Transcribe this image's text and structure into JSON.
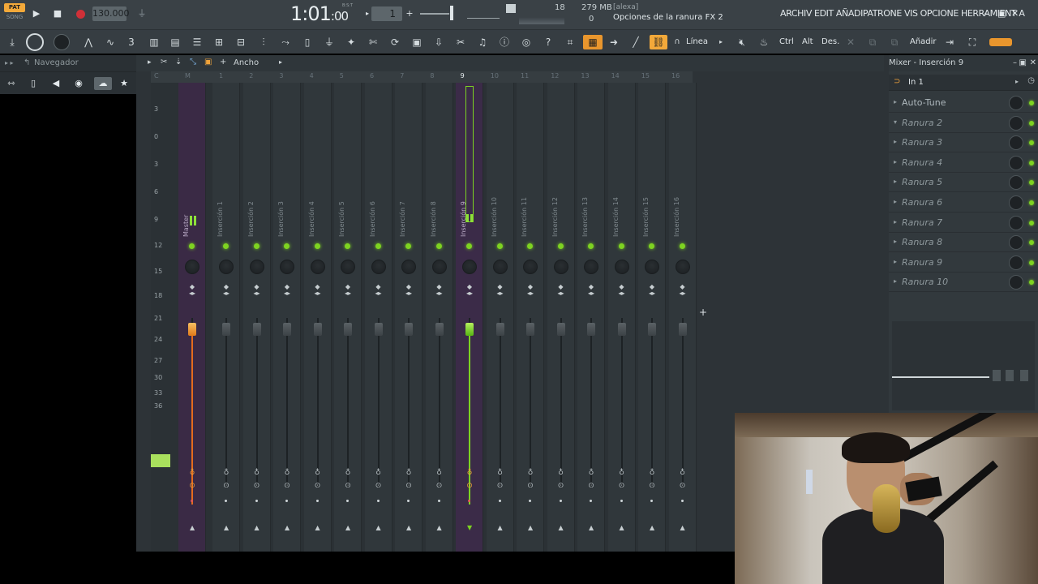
{
  "transport": {
    "pat_label": "PAT",
    "song_label": "SONG",
    "tempo": "130.000",
    "time_main": "1:01",
    "time_sub": ":00",
    "time_unit": "B:S:T",
    "pattern": "1",
    "cpu": "18",
    "mem": "279 MB",
    "voices": "0",
    "hint_title": "[alexa]",
    "hint_text": "Opciones de la ranura FX 2",
    "menu": "ARCHIV EDIT AÑADIPATRONE VIS OPCIONE HERRAMIENT A"
  },
  "toolbar": {
    "line_label": "Línea",
    "ctrl_label": "Ctrl",
    "alt_label": "Alt",
    "des_label": "Des.",
    "add_label": "Añadir"
  },
  "navigator": {
    "title": "Navegador"
  },
  "mixer": {
    "title": "Mixer - Inserción 9",
    "view_label": "Ancho",
    "input": "In 1",
    "db_scale": [
      "3",
      "0",
      "3",
      "6",
      "9",
      "12",
      "15",
      "18",
      "21",
      "24",
      "27",
      "30",
      "33",
      "36"
    ],
    "ruler": [
      "C",
      "M",
      "1",
      "2",
      "3",
      "4",
      "5",
      "6",
      "7",
      "8",
      "9",
      "10",
      "11",
      "12",
      "13",
      "14",
      "15",
      "16"
    ],
    "strips": [
      {
        "label": "Master",
        "type": "master"
      },
      {
        "label": "Inserción 1",
        "type": "normal"
      },
      {
        "label": "Inserción 2",
        "type": "normal"
      },
      {
        "label": "Inserción 3",
        "type": "normal"
      },
      {
        "label": "Inserción 4",
        "type": "normal"
      },
      {
        "label": "Inserción 5",
        "type": "normal"
      },
      {
        "label": "Inserción 6",
        "type": "normal"
      },
      {
        "label": "Inserción 7",
        "type": "normal"
      },
      {
        "label": "Inserción 8",
        "type": "normal"
      },
      {
        "label": "Inserción 9",
        "type": "selected"
      },
      {
        "label": "Inserción 10",
        "type": "normal"
      },
      {
        "label": "Inserción 11",
        "type": "normal"
      },
      {
        "label": "Inserción 12",
        "type": "normal"
      },
      {
        "label": "Inserción 13",
        "type": "normal"
      },
      {
        "label": "Inserción 14",
        "type": "normal"
      },
      {
        "label": "Inserción 15",
        "type": "normal"
      },
      {
        "label": "Inserción 16",
        "type": "normal"
      }
    ],
    "slots": [
      {
        "name": "Auto-Tune",
        "filled": true
      },
      {
        "name": "Ranura 2",
        "filled": false
      },
      {
        "name": "Ranura 3",
        "filled": false
      },
      {
        "name": "Ranura 4",
        "filled": false
      },
      {
        "name": "Ranura 5",
        "filled": false
      },
      {
        "name": "Ranura 6",
        "filled": false
      },
      {
        "name": "Ranura 7",
        "filled": false
      },
      {
        "name": "Ranura 8",
        "filled": false
      },
      {
        "name": "Ranura 9",
        "filled": false
      },
      {
        "name": "Ranura 10",
        "filled": false
      }
    ]
  },
  "colors": {
    "accent_orange": "#e9962d",
    "selected_green": "#7cd321",
    "master_fader": "#e07a1a"
  }
}
